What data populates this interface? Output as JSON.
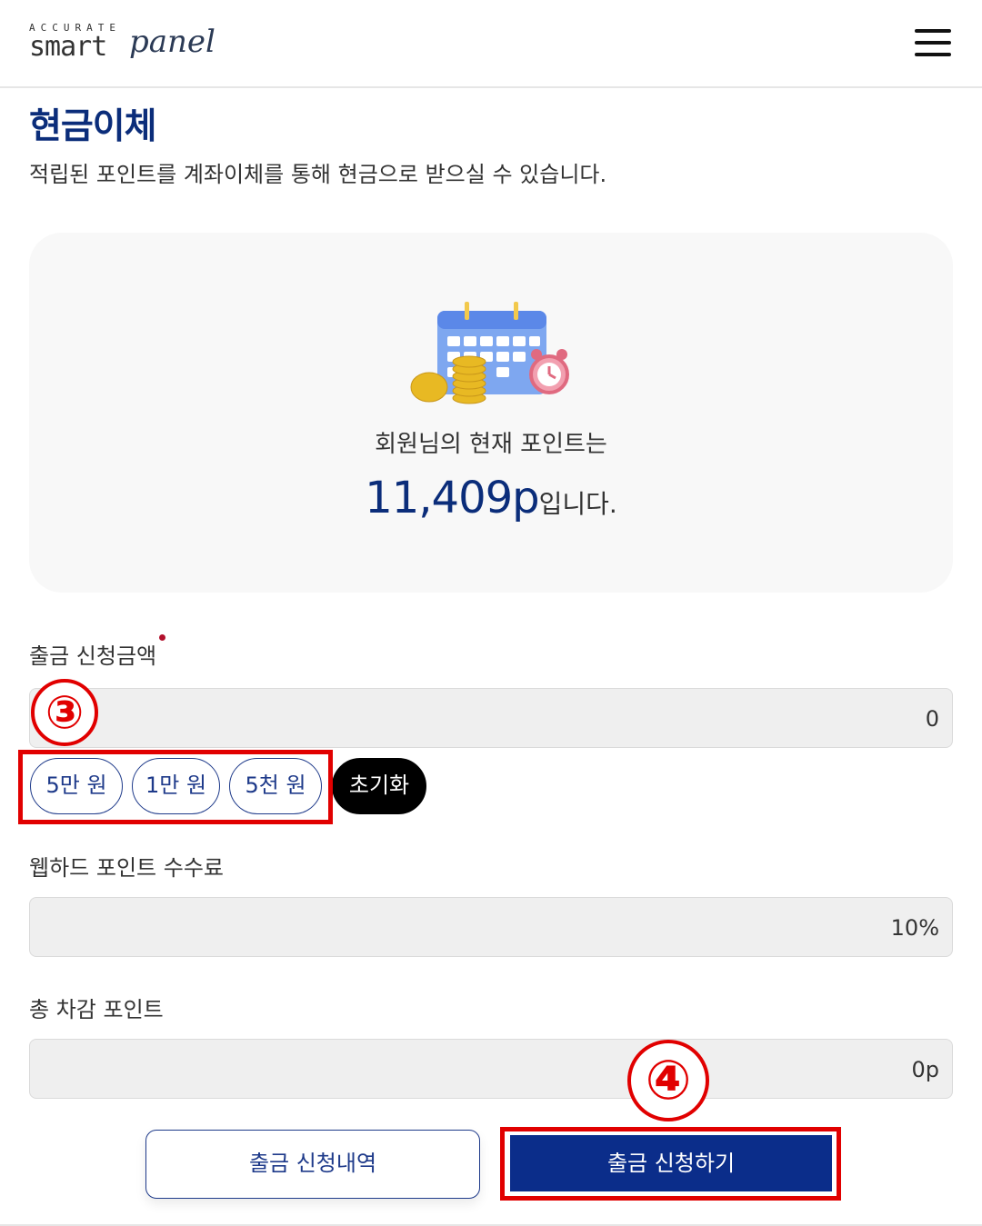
{
  "header": {
    "logo_tag": "ACCURATE",
    "logo_smart": "smart",
    "logo_panel": "panel",
    "menu_icon": "hamburger-menu-icon"
  },
  "page": {
    "title": "현금이체",
    "description": "적립된 포인트를 계좌이체를 통해 현금으로 받으실 수 있습니다."
  },
  "points_card": {
    "illustration": "calendar-coins-alarm-clock-icon",
    "label": "회원님의 현재 포인트는",
    "value": "11,409p",
    "suffix": "입니다."
  },
  "withdraw_amount": {
    "label": "출금 신청금액",
    "value": "0",
    "quick_buttons": [
      "5만 원",
      "1만 원",
      "5천 원"
    ],
    "reset_button": "초기화"
  },
  "fee": {
    "label": "웹하드 포인트 수수료",
    "value": "10%"
  },
  "total": {
    "label": "총 차감 포인트",
    "value": "0p"
  },
  "actions": {
    "history_button": "출금 신청내역",
    "submit_button": "출금 신청하기"
  },
  "annotations": {
    "marker_3": "③",
    "marker_4": "④"
  },
  "colors": {
    "brand_navy": "#0b2d8a",
    "highlight_red": "#e10000",
    "required_dot": "#b2102c"
  }
}
